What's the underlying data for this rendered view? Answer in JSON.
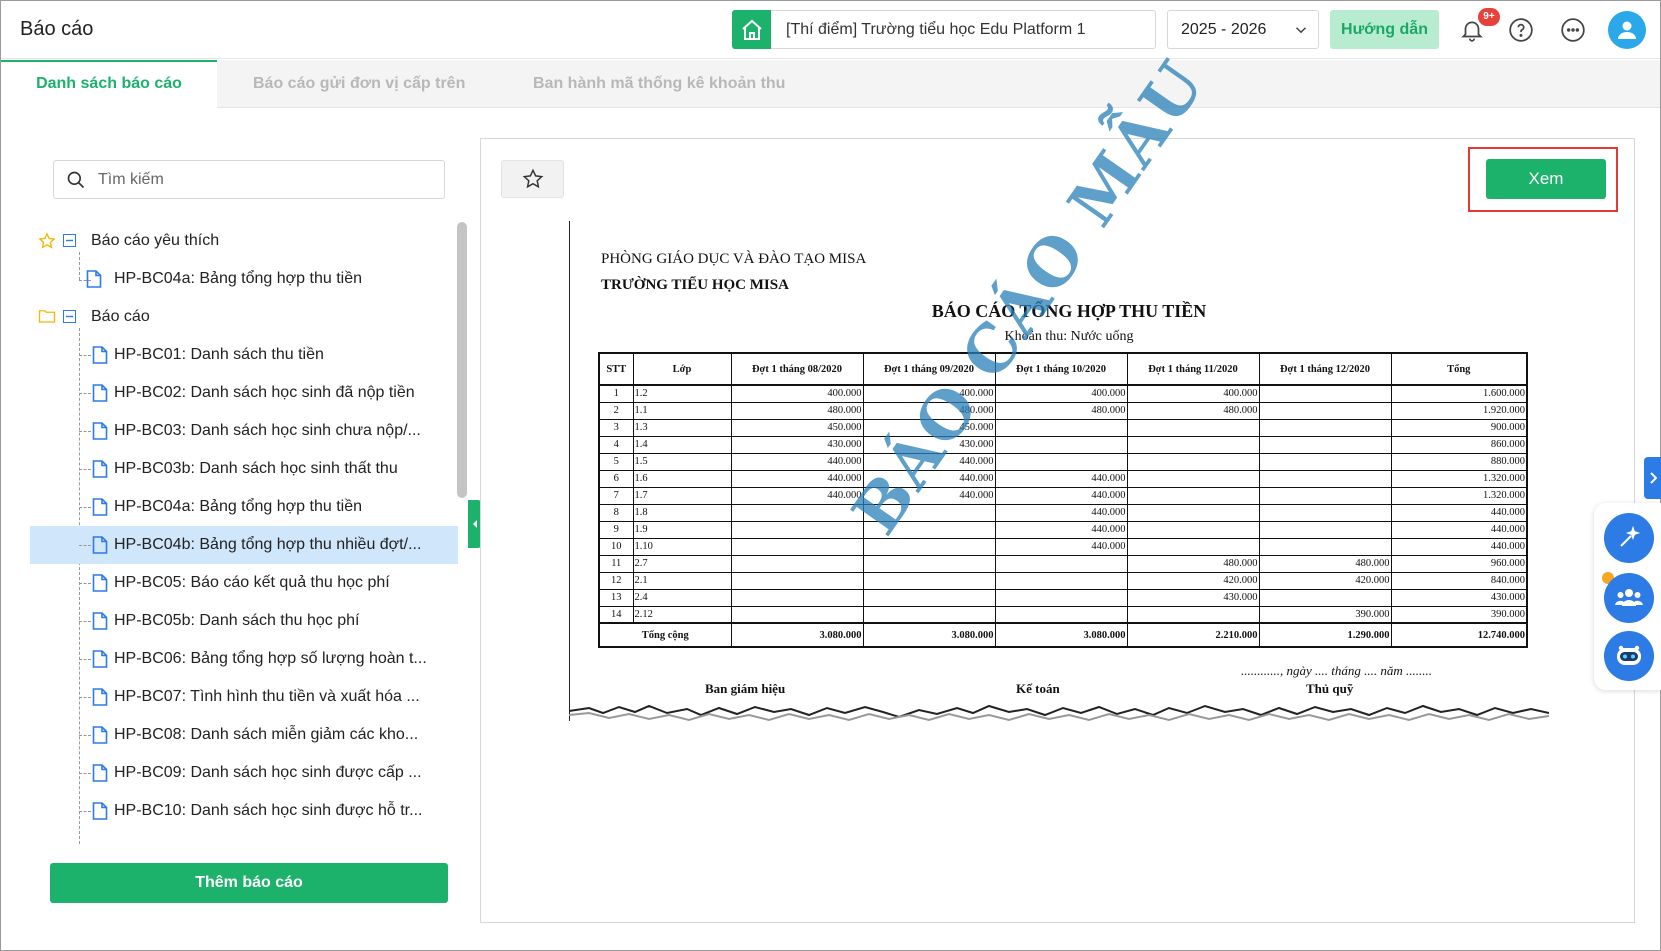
{
  "header": {
    "title": "Báo cáo",
    "school": "[Thí điểm] Trường tiểu học Edu Platform 1",
    "year": "2025 - 2026",
    "guide_label": "Hướng dẫn",
    "notification_badge": "9+"
  },
  "tabs": [
    {
      "label": "Danh sách báo cáo",
      "active": true
    },
    {
      "label": "Báo cáo gửi đơn vị cấp trên",
      "active": false
    },
    {
      "label": "Ban hành mã thống kê khoản thu",
      "active": false
    }
  ],
  "sidebar": {
    "search_placeholder": "Tìm kiếm",
    "favorites_group": "Báo cáo yêu thích",
    "favorites": [
      "HP-BC04a: Bảng tổng hợp thu tiền"
    ],
    "reports_group": "Báo cáo",
    "reports": [
      "HP-BC01: Danh sách thu tiền",
      "HP-BC02: Danh sách học sinh đã nộp tiền",
      "HP-BC03: Danh sách học sinh chưa nộp/...",
      "HP-BC03b: Danh sách học sinh thất thu",
      "HP-BC04a: Bảng tổng hợp thu tiền",
      "HP-BC04b: Bảng tổng hợp thu nhiều đợt/...",
      "HP-BC05: Báo cáo kết quả thu học phí",
      "HP-BC05b: Danh sách thu học phí",
      "HP-BC06: Bảng tổng hợp số lượng hoàn t...",
      "HP-BC07: Tình hình thu tiền và xuất hóa ...",
      "HP-BC08: Danh sách miễn giảm các kho...",
      "HP-BC09: Danh sách học sinh được cấp ...",
      "HP-BC10: Danh sách học sinh được hỗ tr..."
    ],
    "selected_index": 5,
    "add_button": "Thêm báo cáo"
  },
  "preview": {
    "view_button": "Xem",
    "org_line1": "PHÒNG GIÁO DỤC VÀ ĐÀO TẠO MISA",
    "org_line2": "TRƯỜNG TIỂU HỌC MISA",
    "report_title": "BÁO CÁO TỔNG HỢP THU TIỀN",
    "report_subtitle": "Khoản thu: Nước uống",
    "columns": [
      "STT",
      "Lớp",
      "Đợt 1 tháng 08/2020",
      "Đợt 1 tháng 09/2020",
      "Đợt 1 tháng 10/2020",
      "Đợt 1 tháng 11/2020",
      "Đợt 1 tháng 12/2020",
      "Tổng"
    ],
    "rows": [
      [
        "1",
        "1.2",
        "400.000",
        "400.000",
        "400.000",
        "400.000",
        "",
        "1.600.000"
      ],
      [
        "2",
        "1.1",
        "480.000",
        "480.000",
        "480.000",
        "480.000",
        "",
        "1.920.000"
      ],
      [
        "3",
        "1.3",
        "450.000",
        "450.000",
        "",
        "",
        "",
        "900.000"
      ],
      [
        "4",
        "1.4",
        "430.000",
        "430.000",
        "",
        "",
        "",
        "860.000"
      ],
      [
        "5",
        "1.5",
        "440.000",
        "440.000",
        "",
        "",
        "",
        "880.000"
      ],
      [
        "6",
        "1.6",
        "440.000",
        "440.000",
        "440.000",
        "",
        "",
        "1.320.000"
      ],
      [
        "7",
        "1.7",
        "440.000",
        "440.000",
        "440.000",
        "",
        "",
        "1.320.000"
      ],
      [
        "8",
        "1.8",
        "",
        "",
        "440.000",
        "",
        "",
        "440.000"
      ],
      [
        "9",
        "1.9",
        "",
        "",
        "440.000",
        "",
        "",
        "440.000"
      ],
      [
        "10",
        "1.10",
        "",
        "",
        "440.000",
        "",
        "",
        "440.000"
      ],
      [
        "11",
        "2.7",
        "",
        "",
        "",
        "480.000",
        "480.000",
        "960.000"
      ],
      [
        "12",
        "2.1",
        "",
        "",
        "",
        "420.000",
        "420.000",
        "840.000"
      ],
      [
        "13",
        "2.4",
        "",
        "",
        "",
        "430.000",
        "",
        "430.000"
      ],
      [
        "14",
        "2.12",
        "",
        "",
        "",
        "",
        "390.000",
        "390.000"
      ]
    ],
    "total_row": [
      "Tổng cộng",
      "3.080.000",
      "3.080.000",
      "3.080.000",
      "2.210.000",
      "1.290.000",
      "12.740.000"
    ],
    "date_line": "............, ngày .... tháng .... năm ........",
    "signers": [
      "Ban giám hiệu",
      "Kế toán",
      "Thủ quỹ"
    ],
    "watermark": "BÁO CÁO MẪU"
  }
}
